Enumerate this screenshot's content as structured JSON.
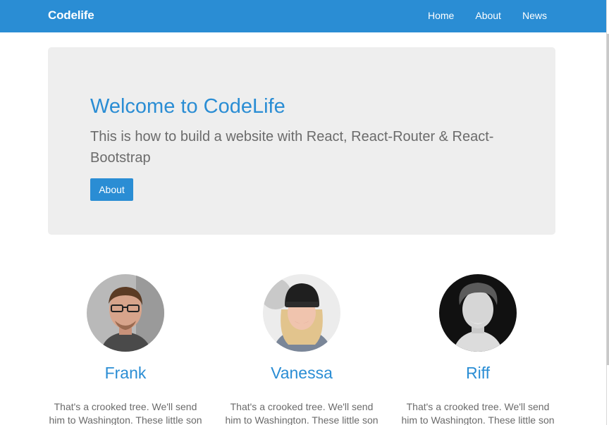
{
  "navbar": {
    "brand": "Codelife",
    "links": [
      "Home",
      "About",
      "News"
    ],
    "color": "#2a8dd4"
  },
  "hero": {
    "title": "Welcome to CodeLife",
    "subtitle": "This is how to build a website with React, React-Router & React-Bootstrap",
    "button_label": "About"
  },
  "people": [
    {
      "name": "Frank",
      "avatar": "person-photo",
      "description": "That's a crooked tree. We'll send him to Washington. These little son"
    },
    {
      "name": "Vanessa",
      "avatar": "person-photo",
      "description": "That's a crooked tree. We'll send him to Washington. These little son"
    },
    {
      "name": "Riff",
      "avatar": "person-photo",
      "description": "That's a crooked tree. We'll send him to Washington. These little son"
    }
  ]
}
